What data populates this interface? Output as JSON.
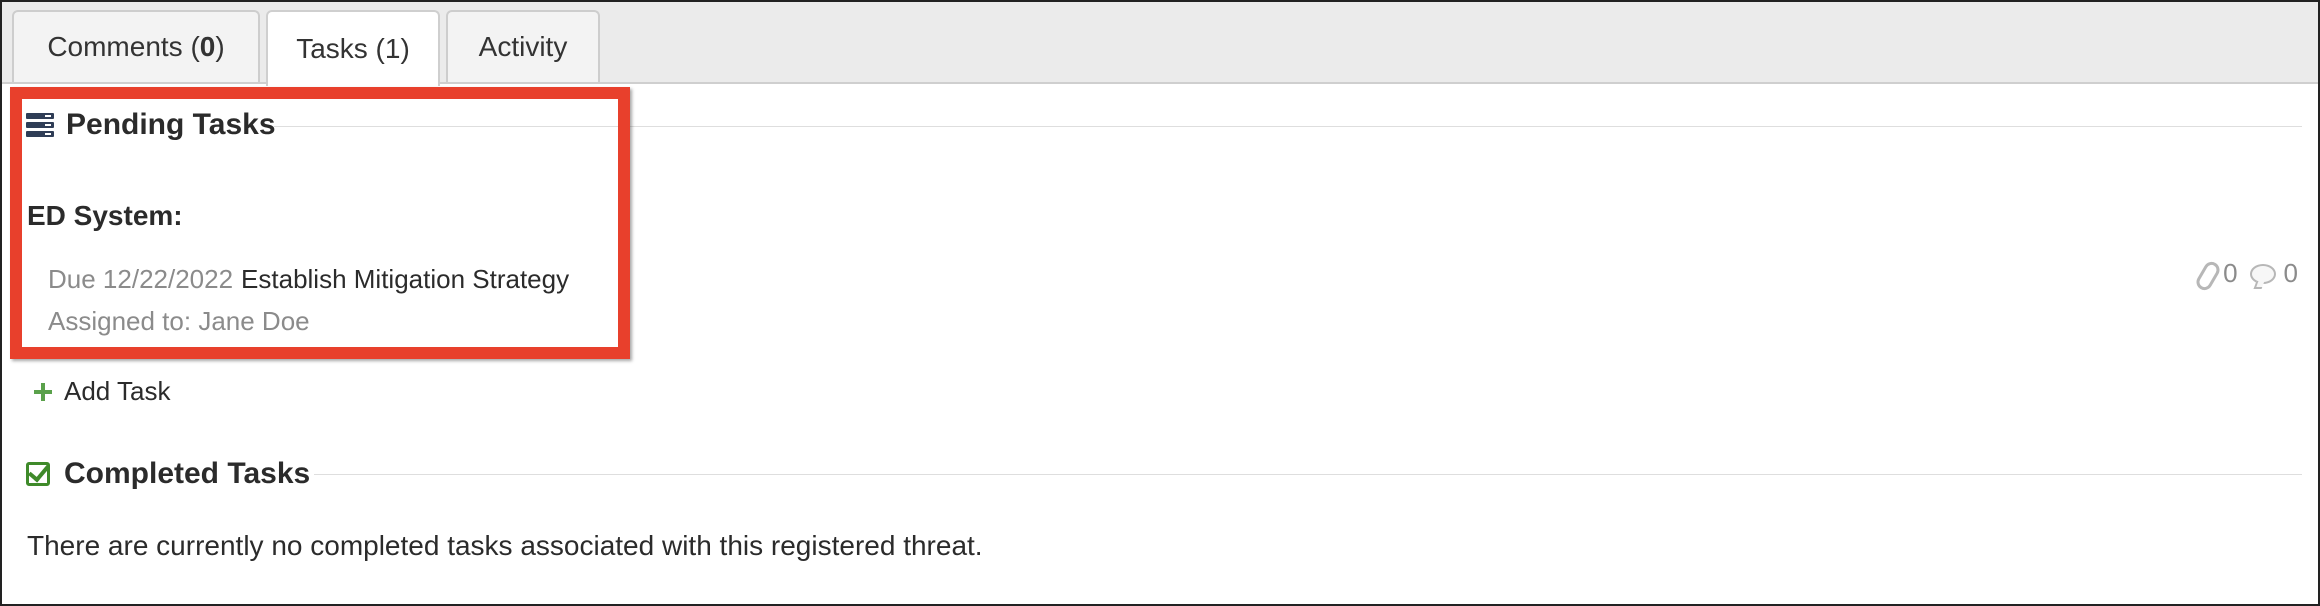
{
  "tabs": [
    {
      "label": "Comments (",
      "count": "0",
      "suffix": ")",
      "active": false
    },
    {
      "label": "Tasks (1)",
      "active": true
    },
    {
      "label": "Activity",
      "active": false
    }
  ],
  "pending": {
    "heading": "Pending Tasks",
    "icon": "tasks-list-icon",
    "group": "ED System:",
    "task": {
      "due": "Due 12/22/2022",
      "name": "Establish Mitigation Strategy",
      "assigned": "Assigned to: Jane Doe",
      "attachments": "0",
      "comments": "0"
    },
    "add_label": "Add Task"
  },
  "completed": {
    "heading": "Completed Tasks",
    "icon": "check-square-icon",
    "empty_message": "There are currently no completed tasks associated with this registered threat."
  },
  "colors": {
    "highlight": "#e8402c",
    "check": "#3f8a2a",
    "add": "#5aa14b"
  }
}
